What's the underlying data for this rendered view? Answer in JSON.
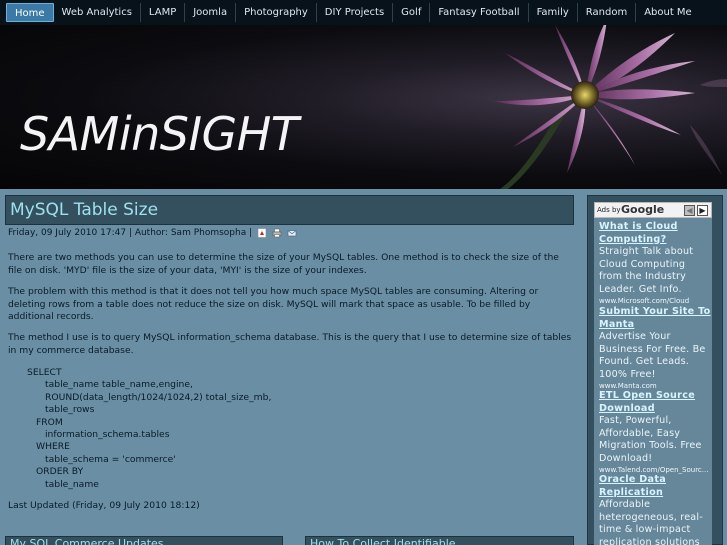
{
  "nav": {
    "items": [
      {
        "label": "Home",
        "active": true
      },
      {
        "label": "Web Analytics"
      },
      {
        "label": "LAMP"
      },
      {
        "label": "Joomla"
      },
      {
        "label": "Photography"
      },
      {
        "label": "DIY Projects"
      },
      {
        "label": "Golf"
      },
      {
        "label": "Fantasy Football"
      },
      {
        "label": "Family"
      },
      {
        "label": "Random"
      },
      {
        "label": "About Me"
      }
    ]
  },
  "banner": {
    "site_title": "SAMinSIGHT"
  },
  "article": {
    "title": "MySQL Table Size",
    "meta": "Friday, 09 July 2010 17:47 | Author: Sam Phomsopha |",
    "paragraphs": [
      "There are two methods you can use to determine the size of your MySQL tables.  One method is to check the size of the file on disk. 'MYD' file is the size of your data, 'MYI' is the size of your indexes.",
      "The problem with this method is that it does not tell you how much space MySQL tables are consuming.  Altering or deleting rows from a table does not reduce the size on disk.  MySQL will mark that space as usable.  To be filled by additional records.",
      "The method I use is to query MySQL information_schema database.  This is the query that I use to determine size of tables in my commerce database."
    ],
    "code_lines": [
      {
        "text": "SELECT",
        "level": 1
      },
      {
        "text": "table_name table_name,engine,",
        "level": 2
      },
      {
        "text": "ROUND(data_length/1024/1024,2) total_size_mb,",
        "level": 2
      },
      {
        "text": "table_rows",
        "level": 2
      },
      {
        "text": "FROM",
        "level": 3
      },
      {
        "text": "information_schema.tables",
        "level": 2
      },
      {
        "text": "WHERE",
        "level": 3
      },
      {
        "text": "table_schema = 'commerce'",
        "level": 2
      },
      {
        "text": "ORDER BY",
        "level": 3
      },
      {
        "text": "table_name",
        "level": 2
      }
    ],
    "last_updated": "Last Updated (Friday, 09 July 2010 18:12)"
  },
  "bottom_boxes": {
    "left_title": "My SQL Commerce Updates",
    "right_title": "How To Collect Identifiable"
  },
  "ads": {
    "ads_by": "Ads by",
    "google": "Google",
    "items": [
      {
        "title": "What is Cloud Computing?",
        "body": "Straight Talk about Cloud Computing from the Industry Leader. Get Info.",
        "url": "www.Microsoft.com/Cloud"
      },
      {
        "title": "Submit Your Site To Manta",
        "body": "Advertise Your Business For Free. Be Found. Get Leads. 100% Free!",
        "url": "www.Manta.com"
      },
      {
        "title": "ETL Open Source Download",
        "body": "Fast, Powerful, Affordable, Easy Migration Tools. Free Download!",
        "url": "www.Talend.com/Open_Sourc..."
      },
      {
        "title": "Oracle Data Replication",
        "body": "Affordable heterogeneous, real-time & low-impact replication solutions",
        "url": ""
      }
    ]
  },
  "icons": {
    "pdf": "pdf-icon",
    "print": "print-icon",
    "email": "email-icon"
  },
  "colors": {
    "nav_active": "#3b7aa7",
    "title_text": "#9fe0ee",
    "page_bg": "#6a8fa5"
  }
}
